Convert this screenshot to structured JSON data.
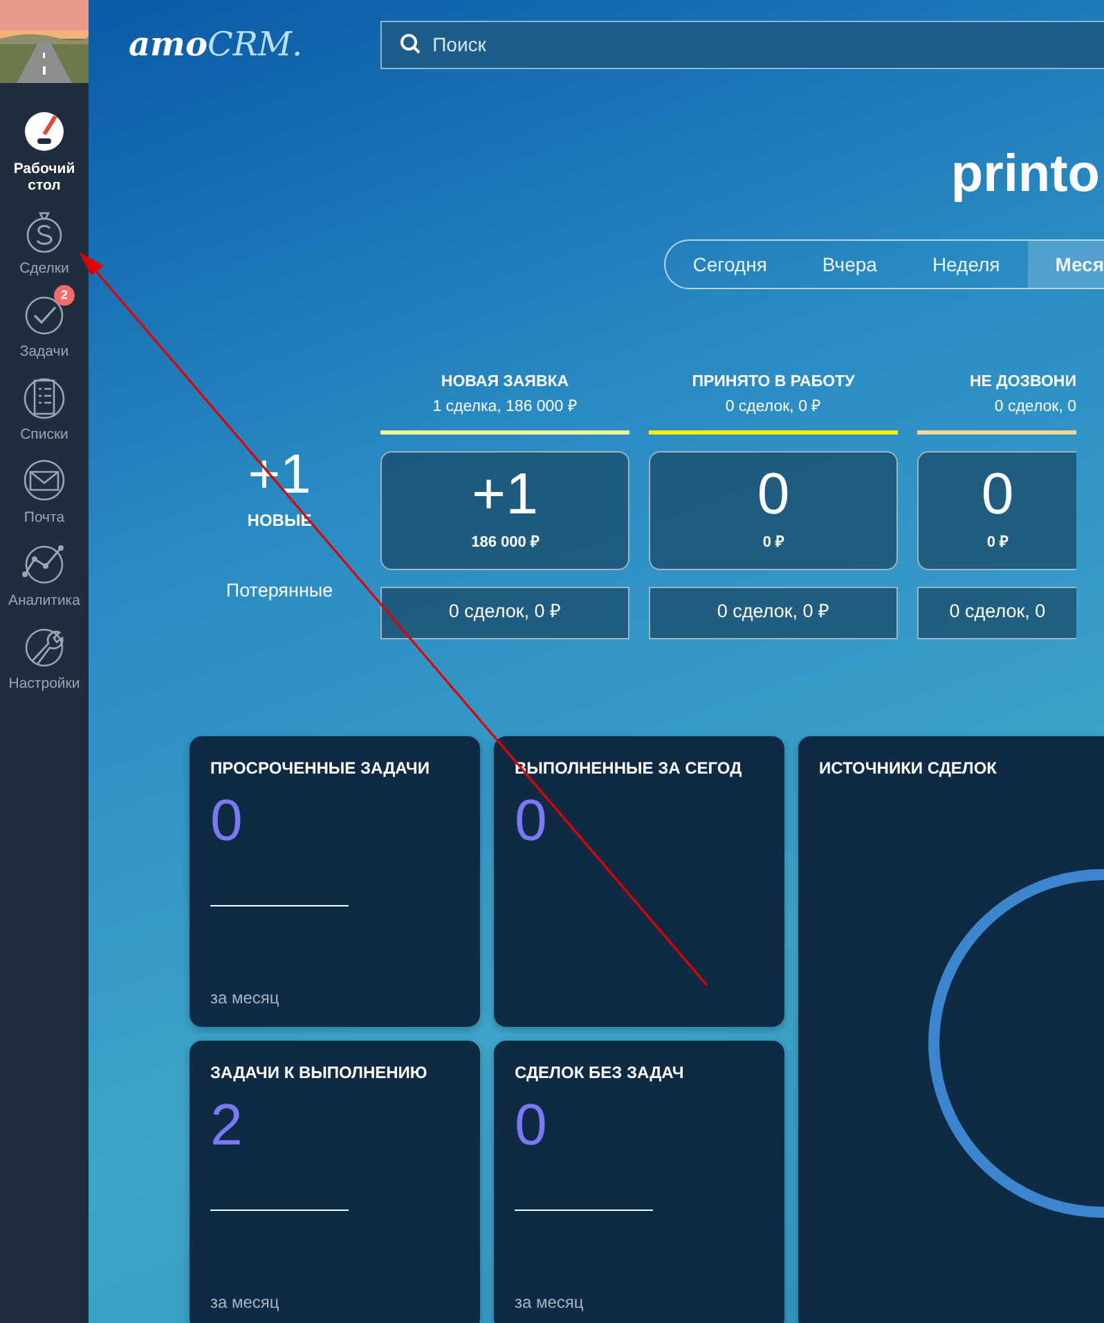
{
  "sidebar": {
    "items": [
      {
        "label": "Рабочий стол",
        "selected": true
      },
      {
        "label": "Сделки",
        "selected": false
      },
      {
        "label": "Задачи",
        "selected": false,
        "badge": "2"
      },
      {
        "label": "Списки",
        "selected": false
      },
      {
        "label": "Почта",
        "selected": false
      },
      {
        "label": "Аналитика",
        "selected": false
      },
      {
        "label": "Настройки",
        "selected": false
      }
    ]
  },
  "header": {
    "logo": {
      "part1": "amo",
      "part2": "CRM."
    },
    "search": {
      "placeholder": "Поиск"
    }
  },
  "account_title": "printo",
  "periods": [
    {
      "label": "Сегодня",
      "selected": false
    },
    {
      "label": "Вчера",
      "selected": false
    },
    {
      "label": "Неделя",
      "selected": false
    },
    {
      "label": "Меся",
      "selected": true
    }
  ],
  "pipeline": {
    "new_count": "+1",
    "new_label": "НОВЫЕ",
    "lost_label": "Потерянные",
    "stages": [
      {
        "name": "НОВАЯ ЗАЯВКА",
        "summary": "1 сделка, 186 000 ₽",
        "color": "#fff59d",
        "count": "+1",
        "amount": "186 000 ₽",
        "lost": "0 сделок, 0 ₽"
      },
      {
        "name": "ПРИНЯТО В РАБОТУ",
        "summary": "0 сделок, 0 ₽",
        "color": "#ffee00",
        "count": "0",
        "amount": "0 ₽",
        "lost": "0 сделок, 0 ₽"
      },
      {
        "name": "НЕ ДОЗВОНИ",
        "summary": "0 сделок, 0",
        "color": "#ffd596",
        "count": "0",
        "amount": "0 ₽",
        "lost": "0 сделок, 0"
      }
    ]
  },
  "widgets": [
    {
      "kind": "counter",
      "title": "ПРОСРОЧЕННЫЕ ЗАДАЧИ",
      "value": "0",
      "footer": "за месяц"
    },
    {
      "kind": "counter",
      "title": "ВЫПОЛНЕННЫЕ ЗА СЕГОД",
      "value": "0"
    },
    {
      "kind": "donut",
      "title": "ИСТОЧНИКИ СДЕЛОК"
    },
    {
      "kind": "counter",
      "title": "ЗАДАЧИ К ВЫПОЛНЕНИЮ",
      "value": "2",
      "footer": "за месяц"
    },
    {
      "kind": "counter",
      "title": "СДЕЛОК БЕЗ ЗАДАЧ",
      "value": "0",
      "footer": "за месяц"
    }
  ]
}
